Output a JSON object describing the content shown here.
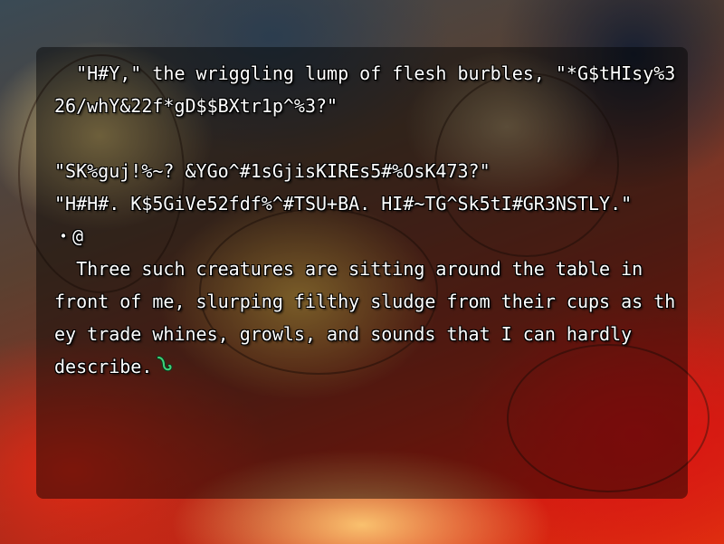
{
  "dialogue": {
    "lines": [
      "  \"H#Y,\" the wriggling lump of flesh burbles, \"*G$tHIsy%3",
      "26/whY&22f*gD$$BXtr1p^%3?\"",
      "",
      "\"SK%guj!%~? &YGo^#1sGjisKIREs5#%OsK473?\"",
      "\"H#H#. K$5GiVe52fdf%^#TSU+BA. HI#~TG^Sk5tI#GR3NSTLY.\"",
      "・@",
      "  Three such creatures are sitting around the table in",
      "front of me, slurping filthy sludge from their cups as th",
      "ey trade whines, growls, and sounds that I can hardly",
      "describe."
    ],
    "continue_icon": "green-hook-cursor-icon",
    "continue_icon_color": "#3fd27a"
  },
  "colors": {
    "textbox_bg": "rgba(0,0,0,0.45)",
    "text": "#ffffff"
  }
}
